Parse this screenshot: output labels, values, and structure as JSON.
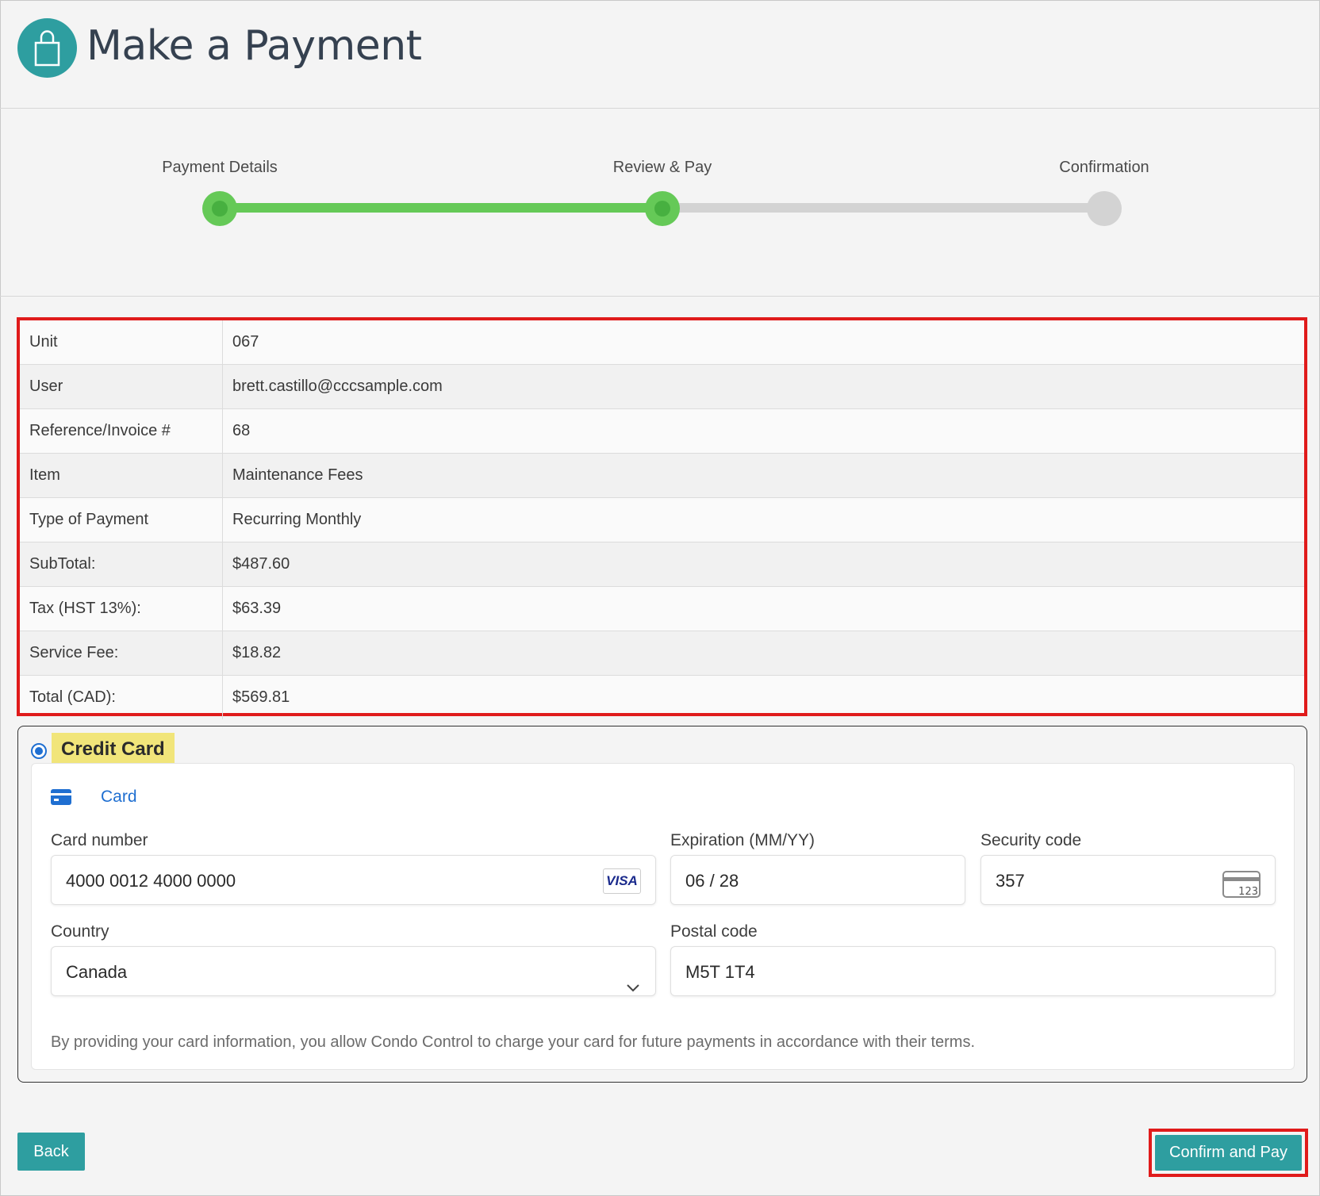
{
  "header": {
    "title": "Make a Payment",
    "logo_icon": "shopping-bag-icon",
    "brand_color": "#2e9ea0"
  },
  "stepper": {
    "steps": [
      {
        "label": "Payment Details",
        "state": "complete"
      },
      {
        "label": "Review & Pay",
        "state": "current"
      },
      {
        "label": "Confirmation",
        "state": "pending"
      }
    ],
    "complete_color": "#65c957",
    "pending_color": "#d3d3d3"
  },
  "summary": {
    "rows": [
      {
        "key": "Unit",
        "value": "067"
      },
      {
        "key": "User",
        "value": "brett.castillo@cccsample.com"
      },
      {
        "key": "Reference/Invoice #",
        "value": "68"
      },
      {
        "key": "Item",
        "value": "Maintenance Fees"
      },
      {
        "key": "Type of Payment",
        "value": "Recurring Monthly"
      },
      {
        "key": "SubTotal:",
        "value": "$487.60"
      },
      {
        "key": "Tax (HST 13%):",
        "value": "$63.39"
      },
      {
        "key": "Service Fee:",
        "value": "$18.82"
      },
      {
        "key": "Total (CAD):",
        "value": "$569.81"
      }
    ],
    "highlight_color": "#e01b1b"
  },
  "payment": {
    "method_label": "Credit Card",
    "method_selected": true,
    "tab_label": "Card",
    "tab_icon": "credit-card-icon",
    "card_number_label": "Card number",
    "card_number_value": "4000 0012 4000 0000",
    "card_brand": "VISA",
    "expiration_label": "Expiration (MM/YY)",
    "expiration_value": "06 / 28",
    "security_label": "Security code",
    "security_value": "357",
    "security_icon_text": "123",
    "country_label": "Country",
    "country_value": "Canada",
    "postal_label": "Postal code",
    "postal_value": "M5T 1T4",
    "consent_text": "By providing your card information, you allow Condo Control to charge your card for future payments in accordance with their terms."
  },
  "footer": {
    "back_label": "Back",
    "confirm_label": "Confirm and Pay"
  }
}
